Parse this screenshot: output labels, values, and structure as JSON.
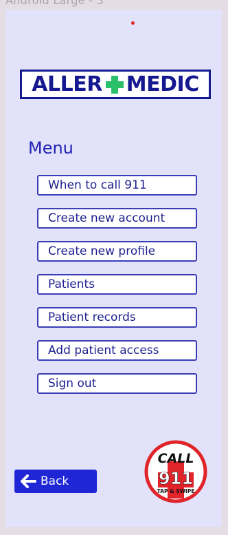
{
  "frame": {
    "label": "Android Large - 3"
  },
  "logo": {
    "left_text": "ALLER",
    "right_text": "MEDIC"
  },
  "menu": {
    "title": "Menu",
    "items": [
      {
        "label": "When to call 911"
      },
      {
        "label": "Create new account"
      },
      {
        "label": "Create new profile"
      },
      {
        "label": "Patients"
      },
      {
        "label": "Patient records"
      },
      {
        "label": "Add patient access"
      },
      {
        "label": "Sign out"
      }
    ]
  },
  "back_button": {
    "label": "Back"
  },
  "call_badge": {
    "top": "CALL",
    "number": "911",
    "bottom": "TAP & SWIPE"
  },
  "colors": {
    "brand_blue": "#15198f",
    "accent_green": "#2bbf6a",
    "back_button": "#1f26d6",
    "emergency_red": "#e0242a"
  }
}
